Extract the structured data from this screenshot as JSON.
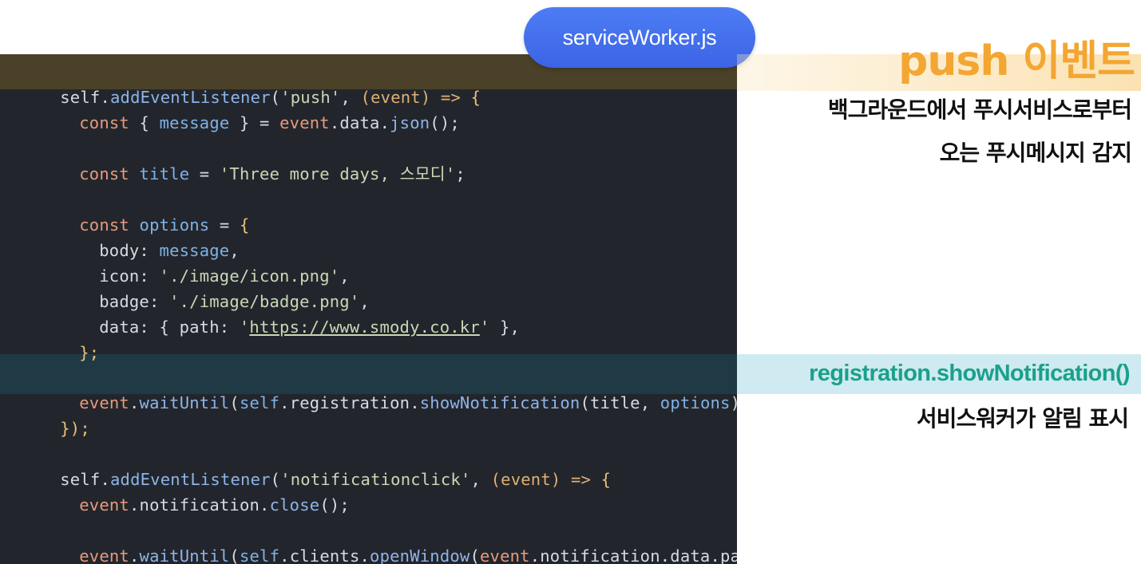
{
  "file_label": "serviceWorker.js",
  "annotations": {
    "push": {
      "title": "push 이벤트",
      "line1": "백그라운드에서 푸시서비스로부터",
      "line2": "오는 푸시메시지 감지"
    },
    "show": {
      "title": "registration.showNotification()",
      "line1": "서비스워커가 알림 표시"
    }
  },
  "code": {
    "l1": [
      "self",
      ".",
      "addEventListener",
      "(",
      "'push'",
      ", ",
      "(event)",
      " => ",
      "{"
    ],
    "l2": [
      "const",
      " { ",
      "message",
      " } = ",
      "event",
      ".data.",
      "json",
      "();"
    ],
    "l3": [
      "const",
      " ",
      "title",
      " = ",
      "'Three more days, 스모디'",
      ";"
    ],
    "l4": [
      "const",
      " ",
      "options",
      " = ",
      "{"
    ],
    "l5": [
      "body: ",
      "message",
      ","
    ],
    "l6": [
      "icon: ",
      "'./image/icon.png'",
      ","
    ],
    "l7": [
      "badge: ",
      "'./image/badge.png'",
      ","
    ],
    "l8": [
      "data: { path: ",
      "'",
      "https://www.smody.co.kr",
      "'",
      " },"
    ],
    "l9": [
      "};"
    ],
    "l10": [
      "event",
      ".",
      "waitUntil",
      "(",
      "self",
      ".",
      "registration",
      ".",
      "showNotification",
      "(",
      "title",
      ", ",
      "options",
      "));"
    ],
    "l11": [
      "});"
    ],
    "l12": [
      "self",
      ".",
      "addEventListener",
      "(",
      "'notificationclick'",
      ", ",
      "(event)",
      " => ",
      "{"
    ],
    "l13": [
      "event",
      ".",
      "notification",
      ".",
      "close",
      "();"
    ],
    "l14": [
      "event",
      ".",
      "waitUntil",
      "(",
      "self",
      ".",
      "clients",
      ".",
      "openWindow",
      "(",
      "event",
      ".notification.data.path))"
    ],
    "l15": [
      "});"
    ]
  }
}
